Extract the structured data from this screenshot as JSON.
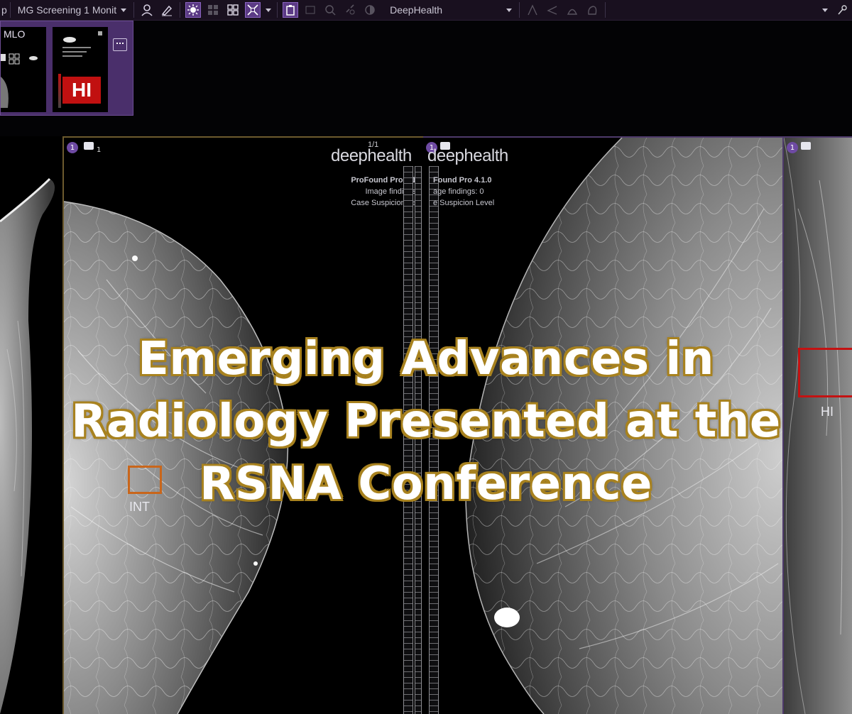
{
  "toolbar": {
    "partial_label": "p",
    "hanging_protocol": "MG Screening 1 Monit",
    "worklist_source": "DeepHealth"
  },
  "thumbnails": {
    "series_label": "MLO",
    "ai_score_label": "HI"
  },
  "viewports": {
    "center": {
      "badge": "1",
      "sub": "1",
      "page": "1/1",
      "brand": "deephealth",
      "product": "ProFound Pro 4.1",
      "image_findings": "Image findings",
      "case_suspicion": "Case Suspicion Le",
      "finding_label": "INT"
    },
    "right": {
      "badge": "1",
      "brand": "deephealth",
      "product": "Found Pro 4.1.0",
      "image_findings": "age findings: 0",
      "case_suspicion": "e Suspicion Level",
      "finding_label": "HI"
    },
    "far": {
      "badge": "1"
    }
  },
  "headline": {
    "line1": "Emerging Advances in",
    "line2": "Radiology Presented at the",
    "line3": "RSNA Conference"
  },
  "colors": {
    "toolbar_bg": "#19101f",
    "thumb_strip": "#4a2f6b",
    "finding_int": "#c9661b",
    "finding_hi": "#c41212",
    "headline_outline": "#a8821f"
  }
}
